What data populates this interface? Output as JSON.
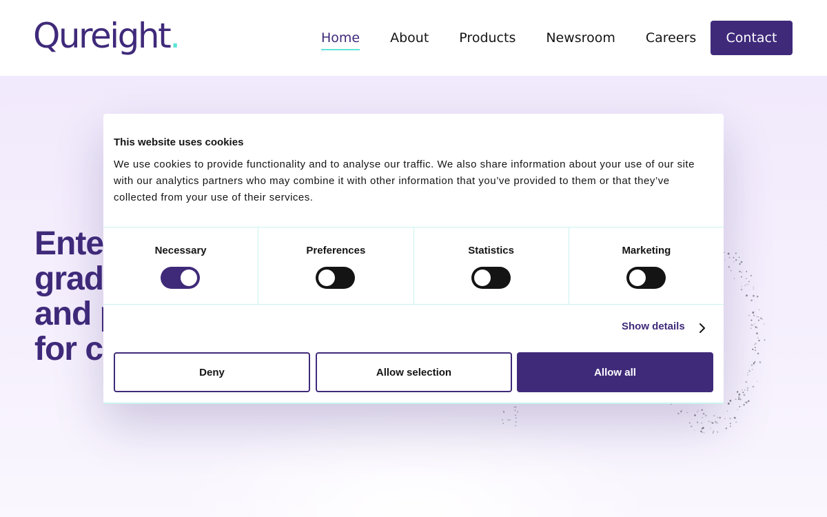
{
  "header": {
    "logo_text": "Qureight",
    "logo_dot": ".",
    "nav": [
      {
        "label": "Home",
        "active": true
      },
      {
        "label": "About",
        "active": false
      },
      {
        "label": "Products",
        "active": false
      },
      {
        "label": "Newsroom",
        "active": false
      },
      {
        "label": "Careers",
        "active": false
      }
    ],
    "contact_label": "Contact"
  },
  "hero": {
    "title_line1": "Ente",
    "title_line2": "grad",
    "title_line3": "and p",
    "title_line4": "for c"
  },
  "cookie_dialog": {
    "title": "This website uses cookies",
    "body": "We use cookies to provide functionality and to analyse our traffic. We also share information about your use of our site with our analytics partners who may combine it with other information that you’ve provided to them or that they’ve collected from your use of their services.",
    "toggles": [
      {
        "label": "Necessary",
        "checked": true
      },
      {
        "label": "Preferences",
        "checked": false
      },
      {
        "label": "Statistics",
        "checked": false
      },
      {
        "label": "Marketing",
        "checked": false
      }
    ],
    "show_details_label": "Show details",
    "deny_label": "Deny",
    "allow_selection_label": "Allow selection",
    "allow_all_label": "Allow all"
  },
  "colors": {
    "brand": "#3f2a7a",
    "accent": "#5fe3d6",
    "toggle_off": "#141414"
  }
}
